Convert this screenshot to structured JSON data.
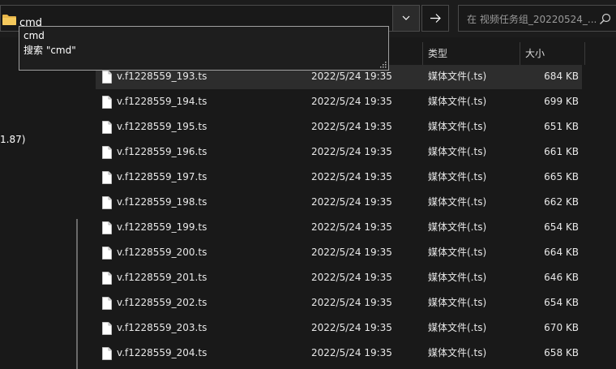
{
  "address_bar": {
    "path_text": "cmd",
    "search_placeholder": "在 视频任务组_20220524_..."
  },
  "nav_pane": {
    "partial_text": "1.87)"
  },
  "columns": {
    "type_label": "类型",
    "size_label": "大小"
  },
  "autocomplete": {
    "items": [
      {
        "label": "cmd"
      },
      {
        "label": "搜索 \"cmd\""
      }
    ]
  },
  "files": [
    {
      "name": "v.f1228559_193.ts",
      "date": "2022/5/24 19:35",
      "type": "媒体文件(.ts)",
      "size": "684 KB",
      "selected": true
    },
    {
      "name": "v.f1228559_194.ts",
      "date": "2022/5/24 19:35",
      "type": "媒体文件(.ts)",
      "size": "699 KB"
    },
    {
      "name": "v.f1228559_195.ts",
      "date": "2022/5/24 19:35",
      "type": "媒体文件(.ts)",
      "size": "651 KB"
    },
    {
      "name": "v.f1228559_196.ts",
      "date": "2022/5/24 19:35",
      "type": "媒体文件(.ts)",
      "size": "661 KB"
    },
    {
      "name": "v.f1228559_197.ts",
      "date": "2022/5/24 19:35",
      "type": "媒体文件(.ts)",
      "size": "665 KB"
    },
    {
      "name": "v.f1228559_198.ts",
      "date": "2022/5/24 19:35",
      "type": "媒体文件(.ts)",
      "size": "662 KB"
    },
    {
      "name": "v.f1228559_199.ts",
      "date": "2022/5/24 19:35",
      "type": "媒体文件(.ts)",
      "size": "654 KB"
    },
    {
      "name": "v.f1228559_200.ts",
      "date": "2022/5/24 19:35",
      "type": "媒体文件(.ts)",
      "size": "664 KB"
    },
    {
      "name": "v.f1228559_201.ts",
      "date": "2022/5/24 19:35",
      "type": "媒体文件(.ts)",
      "size": "646 KB"
    },
    {
      "name": "v.f1228559_202.ts",
      "date": "2022/5/24 19:35",
      "type": "媒体文件(.ts)",
      "size": "654 KB"
    },
    {
      "name": "v.f1228559_203.ts",
      "date": "2022/5/24 19:35",
      "type": "媒体文件(.ts)",
      "size": "670 KB"
    },
    {
      "name": "v.f1228559_204.ts",
      "date": "2022/5/24 19:35",
      "type": "媒体文件(.ts)",
      "size": "658 KB"
    }
  ]
}
